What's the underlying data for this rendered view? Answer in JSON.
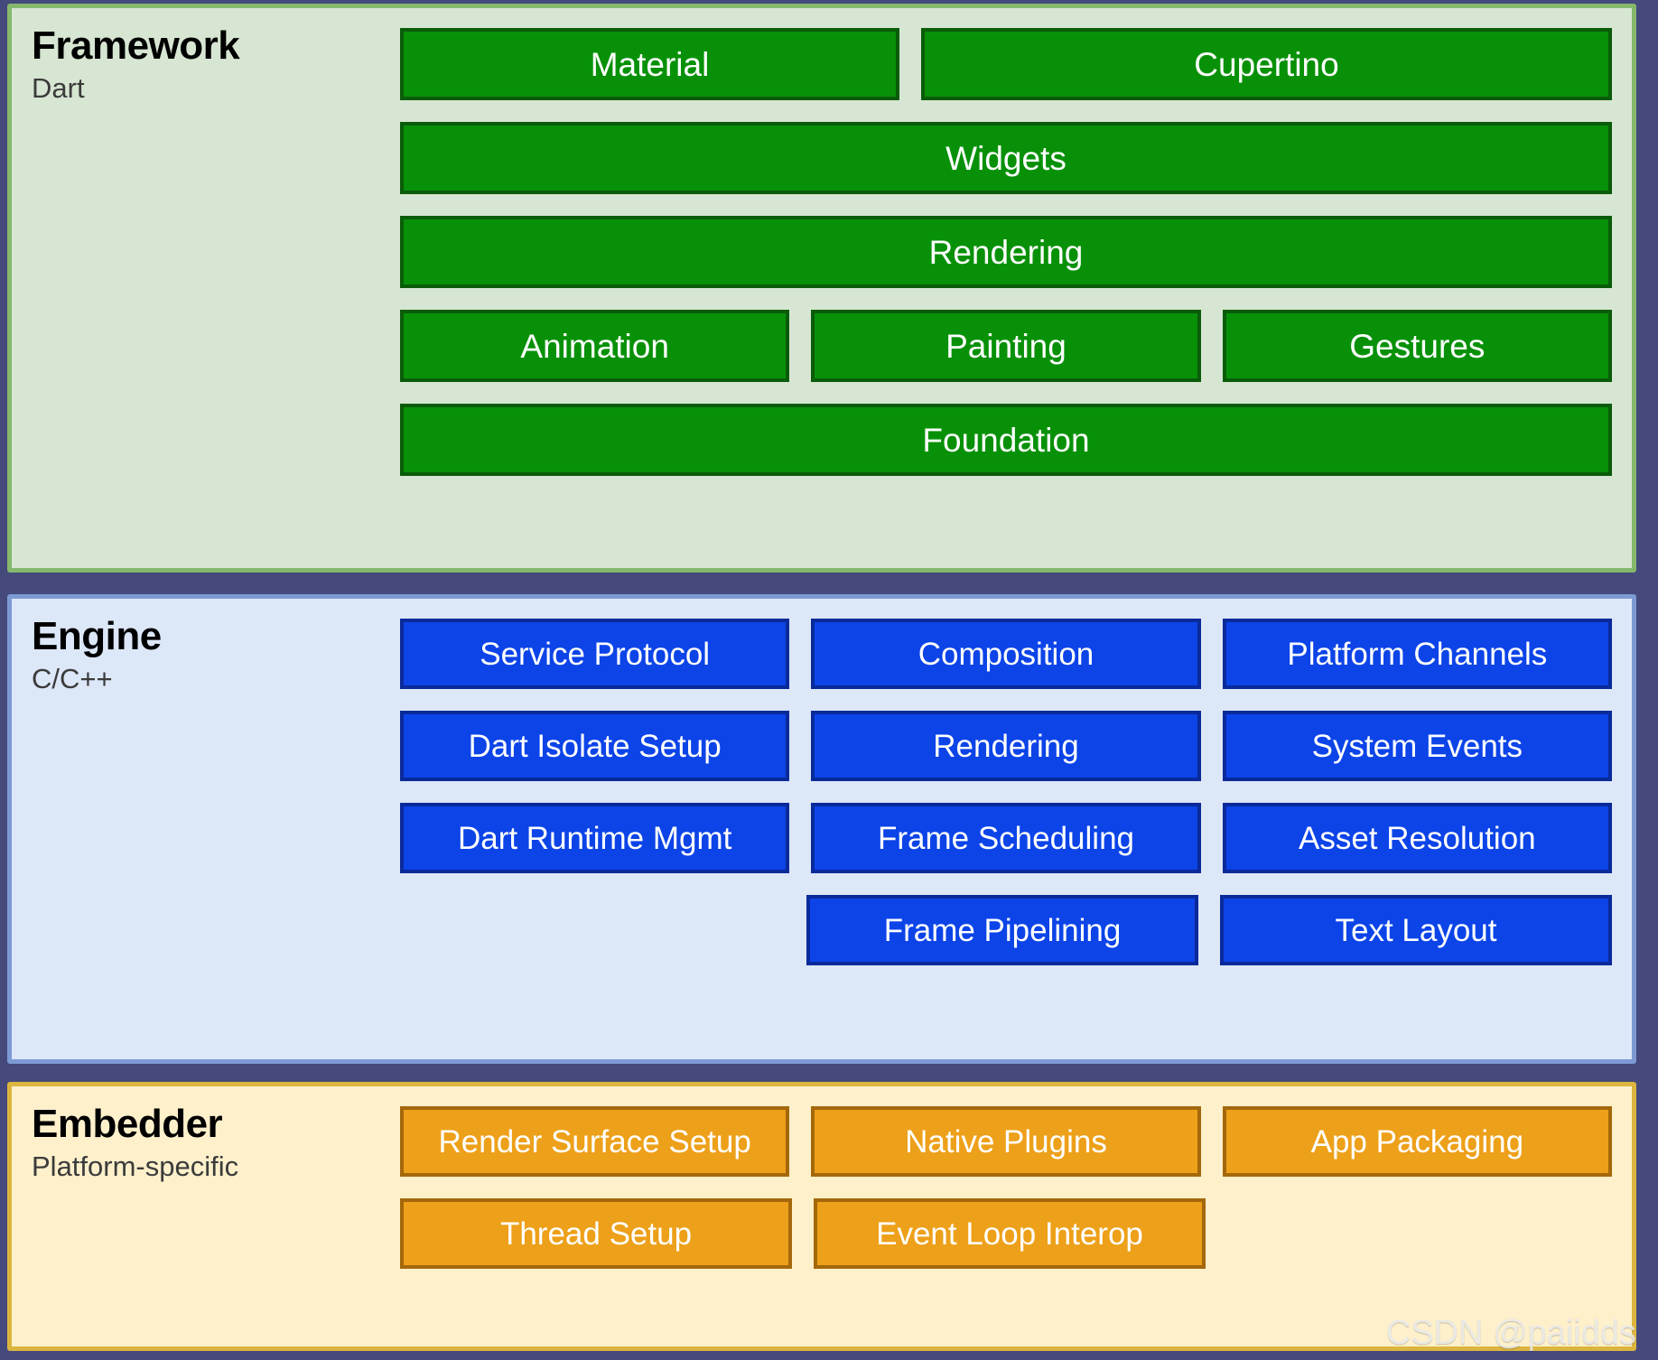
{
  "watermark": "CSDN @paiidds",
  "layers": [
    {
      "id": "framework",
      "title": "Framework",
      "subtitle": "Dart",
      "accent": "#089108",
      "panel_bg": "#d7e6d2",
      "panel_border": "#85b86d",
      "rows": [
        {
          "cells": [
            {
              "label": "Material",
              "kind": "box"
            },
            {
              "label": "Cupertino",
              "kind": "box"
            }
          ]
        },
        {
          "cells": [
            {
              "label": "Widgets",
              "kind": "box"
            }
          ]
        },
        {
          "cells": [
            {
              "label": "Rendering",
              "kind": "box"
            }
          ]
        },
        {
          "cells": [
            {
              "label": "Animation",
              "kind": "box"
            },
            {
              "label": "Painting",
              "kind": "box"
            },
            {
              "label": "Gestures",
              "kind": "box"
            }
          ]
        },
        {
          "cells": [
            {
              "label": "Foundation",
              "kind": "box"
            }
          ]
        }
      ]
    },
    {
      "id": "engine",
      "title": "Engine",
      "subtitle": "C/C++",
      "accent": "#0c44e8",
      "panel_bg": "#dce7f8",
      "panel_border": "#7c9ad4",
      "rows": [
        {
          "cells": [
            {
              "label": "Service Protocol",
              "kind": "box"
            },
            {
              "label": "Composition",
              "kind": "box"
            },
            {
              "label": "Platform Channels",
              "kind": "box"
            }
          ]
        },
        {
          "cells": [
            {
              "label": "Dart Isolate Setup",
              "kind": "box"
            },
            {
              "label": "Rendering",
              "kind": "box"
            },
            {
              "label": "System Events",
              "kind": "box"
            }
          ]
        },
        {
          "cells": [
            {
              "label": "Dart Runtime Mgmt",
              "kind": "box"
            },
            {
              "label": "Frame Scheduling",
              "kind": "box"
            },
            {
              "label": "Asset Resolution",
              "kind": "box"
            }
          ]
        },
        {
          "cells": [
            {
              "label": "",
              "kind": "spacer"
            },
            {
              "label": "Frame Pipelining",
              "kind": "box"
            },
            {
              "label": "Text Layout",
              "kind": "box"
            }
          ]
        }
      ]
    },
    {
      "id": "embedder",
      "title": "Embedder",
      "subtitle": "Platform-specific",
      "accent": "#eda019",
      "panel_bg": "#fdf0cb",
      "panel_border": "#dcb53f",
      "rows": [
        {
          "cells": [
            {
              "label": "Render Surface Setup",
              "kind": "box"
            },
            {
              "label": "Native Plugins",
              "kind": "box"
            },
            {
              "label": "App Packaging",
              "kind": "box"
            }
          ]
        },
        {
          "cells": [
            {
              "label": "Thread Setup",
              "kind": "box"
            },
            {
              "label": "Event Loop Interop",
              "kind": "box"
            },
            {
              "label": "",
              "kind": "spacer"
            }
          ]
        }
      ]
    }
  ]
}
